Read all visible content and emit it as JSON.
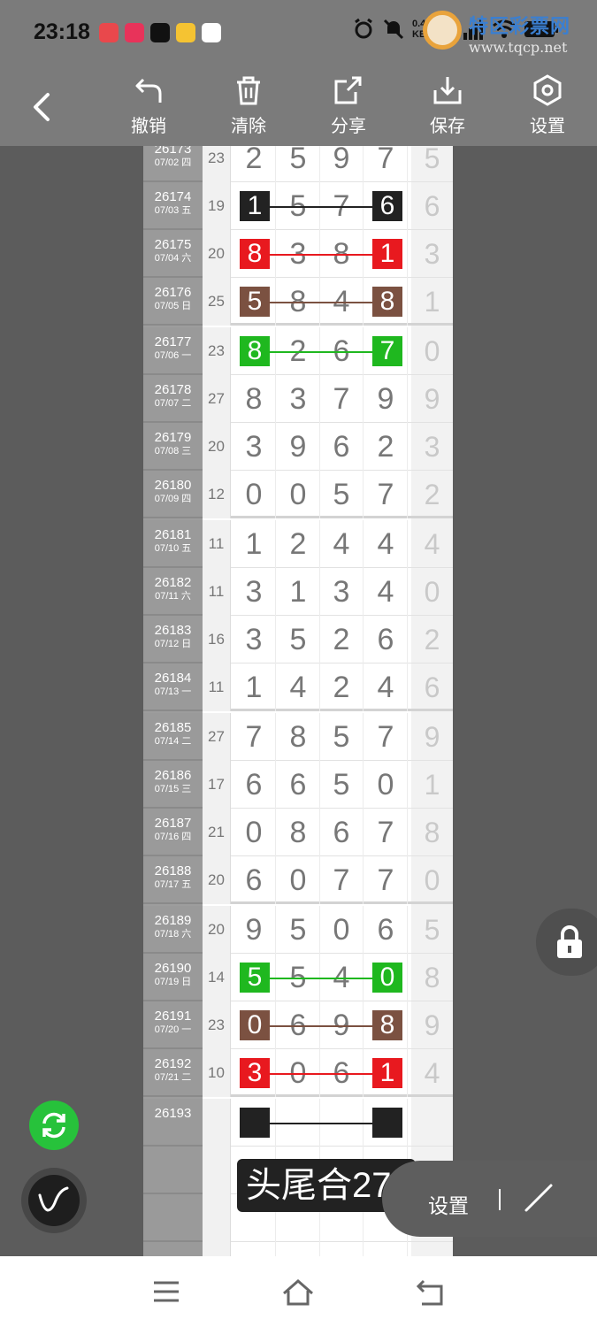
{
  "status_bar": {
    "time": "23:18",
    "network_speed": "0.41\nKB/s",
    "network_type": "5G",
    "app_icon_colors": [
      "#e9484c",
      "#e8335a",
      "#111111",
      "#f5c332",
      "#ffffff"
    ]
  },
  "watermark": {
    "title": "特区彩票网",
    "url": "www.tqcp.net"
  },
  "toolbar": {
    "back_label": "",
    "undo_label": "撤销",
    "clear_label": "清除",
    "share_label": "分享",
    "save_label": "保存",
    "settings_label": "设置"
  },
  "colors": {
    "black": "#222222",
    "red": "#e8191f",
    "brown": "#7b5141",
    "green": "#1fb81f"
  },
  "rows": [
    {
      "id": "26173",
      "date": "07/02 四",
      "sum": "23",
      "digits": [
        "2",
        "5",
        "9",
        "7"
      ],
      "tail": "5",
      "mark": null,
      "gap": false
    },
    {
      "id": "26174",
      "date": "07/03 五",
      "sum": "19",
      "digits": [
        "1",
        "5",
        "7",
        "6"
      ],
      "tail": "6",
      "mark": "black",
      "gap": false
    },
    {
      "id": "26175",
      "date": "07/04 六",
      "sum": "20",
      "digits": [
        "8",
        "3",
        "8",
        "1"
      ],
      "tail": "3",
      "mark": "red",
      "gap": false
    },
    {
      "id": "26176",
      "date": "07/05 日",
      "sum": "25",
      "digits": [
        "5",
        "8",
        "4",
        "8"
      ],
      "tail": "1",
      "mark": "brown",
      "gap": true
    },
    {
      "id": "26177",
      "date": "07/06 一",
      "sum": "23",
      "digits": [
        "8",
        "2",
        "6",
        "7"
      ],
      "tail": "0",
      "mark": "green",
      "gap": false
    },
    {
      "id": "26178",
      "date": "07/07 二",
      "sum": "27",
      "digits": [
        "8",
        "3",
        "7",
        "9"
      ],
      "tail": "9",
      "mark": null,
      "gap": false
    },
    {
      "id": "26179",
      "date": "07/08 三",
      "sum": "20",
      "digits": [
        "3",
        "9",
        "6",
        "2"
      ],
      "tail": "3",
      "mark": null,
      "gap": false
    },
    {
      "id": "26180",
      "date": "07/09 四",
      "sum": "12",
      "digits": [
        "0",
        "0",
        "5",
        "7"
      ],
      "tail": "2",
      "mark": null,
      "gap": true
    },
    {
      "id": "26181",
      "date": "07/10 五",
      "sum": "11",
      "digits": [
        "1",
        "2",
        "4",
        "4"
      ],
      "tail": "4",
      "mark": null,
      "gap": false
    },
    {
      "id": "26182",
      "date": "07/11 六",
      "sum": "11",
      "digits": [
        "3",
        "1",
        "3",
        "4"
      ],
      "tail": "0",
      "mark": null,
      "gap": false
    },
    {
      "id": "26183",
      "date": "07/12 日",
      "sum": "16",
      "digits": [
        "3",
        "5",
        "2",
        "6"
      ],
      "tail": "2",
      "mark": null,
      "gap": false
    },
    {
      "id": "26184",
      "date": "07/13 一",
      "sum": "11",
      "digits": [
        "1",
        "4",
        "2",
        "4"
      ],
      "tail": "6",
      "mark": null,
      "gap": true
    },
    {
      "id": "26185",
      "date": "07/14 二",
      "sum": "27",
      "digits": [
        "7",
        "8",
        "5",
        "7"
      ],
      "tail": "9",
      "mark": null,
      "gap": false
    },
    {
      "id": "26186",
      "date": "07/15 三",
      "sum": "17",
      "digits": [
        "6",
        "6",
        "5",
        "0"
      ],
      "tail": "1",
      "mark": null,
      "gap": false
    },
    {
      "id": "26187",
      "date": "07/16 四",
      "sum": "21",
      "digits": [
        "0",
        "8",
        "6",
        "7"
      ],
      "tail": "8",
      "mark": null,
      "gap": false
    },
    {
      "id": "26188",
      "date": "07/17 五",
      "sum": "20",
      "digits": [
        "6",
        "0",
        "7",
        "7"
      ],
      "tail": "0",
      "mark": null,
      "gap": true
    },
    {
      "id": "26189",
      "date": "07/18 六",
      "sum": "20",
      "digits": [
        "9",
        "5",
        "0",
        "6"
      ],
      "tail": "5",
      "mark": null,
      "gap": false
    },
    {
      "id": "26190",
      "date": "07/19 日",
      "sum": "14",
      "digits": [
        "5",
        "5",
        "4",
        "0"
      ],
      "tail": "8",
      "mark": "green",
      "gap": false
    },
    {
      "id": "26191",
      "date": "07/20 一",
      "sum": "23",
      "digits": [
        "0",
        "6",
        "9",
        "8"
      ],
      "tail": "9",
      "mark": "brown",
      "gap": false
    },
    {
      "id": "26192",
      "date": "07/21 二",
      "sum": "10",
      "digits": [
        "3",
        "0",
        "6",
        "1"
      ],
      "tail": "4",
      "mark": "red",
      "gap": true
    },
    {
      "id": "26193",
      "date": "",
      "sum": "",
      "digits": [
        "",
        "",
        "",
        ""
      ],
      "tail": "",
      "mark": "black",
      "gap": false
    },
    {
      "id": "",
      "date": "",
      "sum": "",
      "digits": [
        "",
        "",
        "",
        ""
      ],
      "tail": "",
      "mark": null,
      "gap": false
    },
    {
      "id": "",
      "date": "",
      "sum": "",
      "digits": [
        "",
        "",
        "",
        ""
      ],
      "tail": "",
      "mark": null,
      "gap": false
    },
    {
      "id": "",
      "date": "",
      "sum": "",
      "digits": [
        "",
        "",
        "",
        ""
      ],
      "tail": "",
      "mark": null,
      "gap": false
    }
  ],
  "overlay": {
    "label": "头尾合27",
    "settings_label": "设置"
  },
  "nav": {
    "menu": "menu-icon",
    "home": "home-icon",
    "back": "back-icon"
  }
}
